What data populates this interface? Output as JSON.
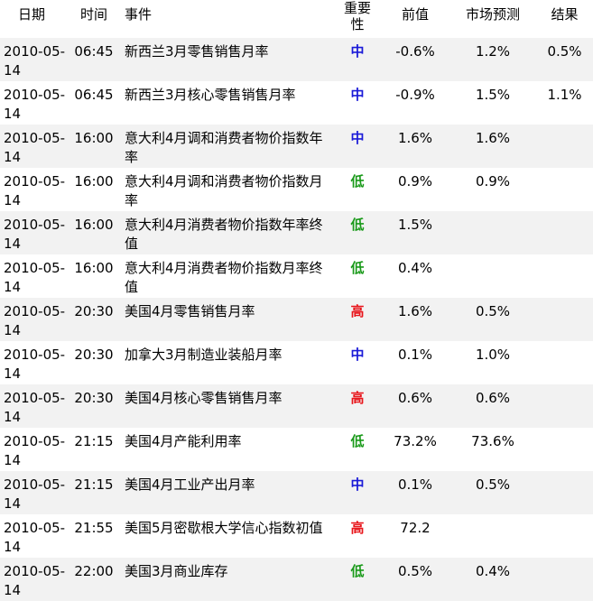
{
  "columns": {
    "date": "日期",
    "time": "时间",
    "event": "事件",
    "importance": "重要\n性",
    "previous": "前值",
    "forecast": "市场预测",
    "actual": "结果"
  },
  "importance_colors": {
    "高": "#e8151b",
    "中": "#1a1ad8",
    "低": "#1a9a1a"
  },
  "rows": [
    {
      "date": "2010-05-14",
      "time": "06:45",
      "event": "新西兰3月零售销售月率",
      "importance": "中",
      "previous": "-0.6%",
      "forecast": "1.2%",
      "actual": "0.5%"
    },
    {
      "date": "2010-05-14",
      "time": "06:45",
      "event": "新西兰3月核心零售销售月率",
      "importance": "中",
      "previous": "-0.9%",
      "forecast": "1.5%",
      "actual": "1.1%"
    },
    {
      "date": "2010-05-14",
      "time": "16:00",
      "event": "意大利4月调和消费者物价指数年率",
      "importance": "中",
      "previous": "1.6%",
      "forecast": "1.6%",
      "actual": ""
    },
    {
      "date": "2010-05-14",
      "time": "16:00",
      "event": "意大利4月调和消费者物价指数月率",
      "importance": "低",
      "previous": "0.9%",
      "forecast": "0.9%",
      "actual": ""
    },
    {
      "date": "2010-05-14",
      "time": "16:00",
      "event": "意大利4月消费者物价指数年率终值",
      "importance": "低",
      "previous": "1.5%",
      "forecast": "",
      "actual": ""
    },
    {
      "date": "2010-05-14",
      "time": "16:00",
      "event": "意大利4月消费者物价指数月率终值",
      "importance": "低",
      "previous": "0.4%",
      "forecast": "",
      "actual": ""
    },
    {
      "date": "2010-05-14",
      "time": "20:30",
      "event": "美国4月零售销售月率",
      "importance": "高",
      "previous": "1.6%",
      "forecast": "0.5%",
      "actual": ""
    },
    {
      "date": "2010-05-14",
      "time": "20:30",
      "event": "加拿大3月制造业装船月率",
      "importance": "中",
      "previous": "0.1%",
      "forecast": "1.0%",
      "actual": ""
    },
    {
      "date": "2010-05-14",
      "time": "20:30",
      "event": "美国4月核心零售销售月率",
      "importance": "高",
      "previous": "0.6%",
      "forecast": "0.6%",
      "actual": ""
    },
    {
      "date": "2010-05-14",
      "time": "21:15",
      "event": "美国4月产能利用率",
      "importance": "低",
      "previous": "73.2%",
      "forecast": "73.6%",
      "actual": ""
    },
    {
      "date": "2010-05-14",
      "time": "21:15",
      "event": "美国4月工业产出月率",
      "importance": "中",
      "previous": "0.1%",
      "forecast": "0.5%",
      "actual": ""
    },
    {
      "date": "2010-05-14",
      "time": "21:55",
      "event": "美国5月密歇根大学信心指数初值",
      "importance": "高",
      "previous": "72.2",
      "forecast": "",
      "actual": ""
    },
    {
      "date": "2010-05-14",
      "time": "22:00",
      "event": "美国3月商业库存",
      "importance": "低",
      "previous": "0.5%",
      "forecast": "0.4%",
      "actual": ""
    }
  ]
}
